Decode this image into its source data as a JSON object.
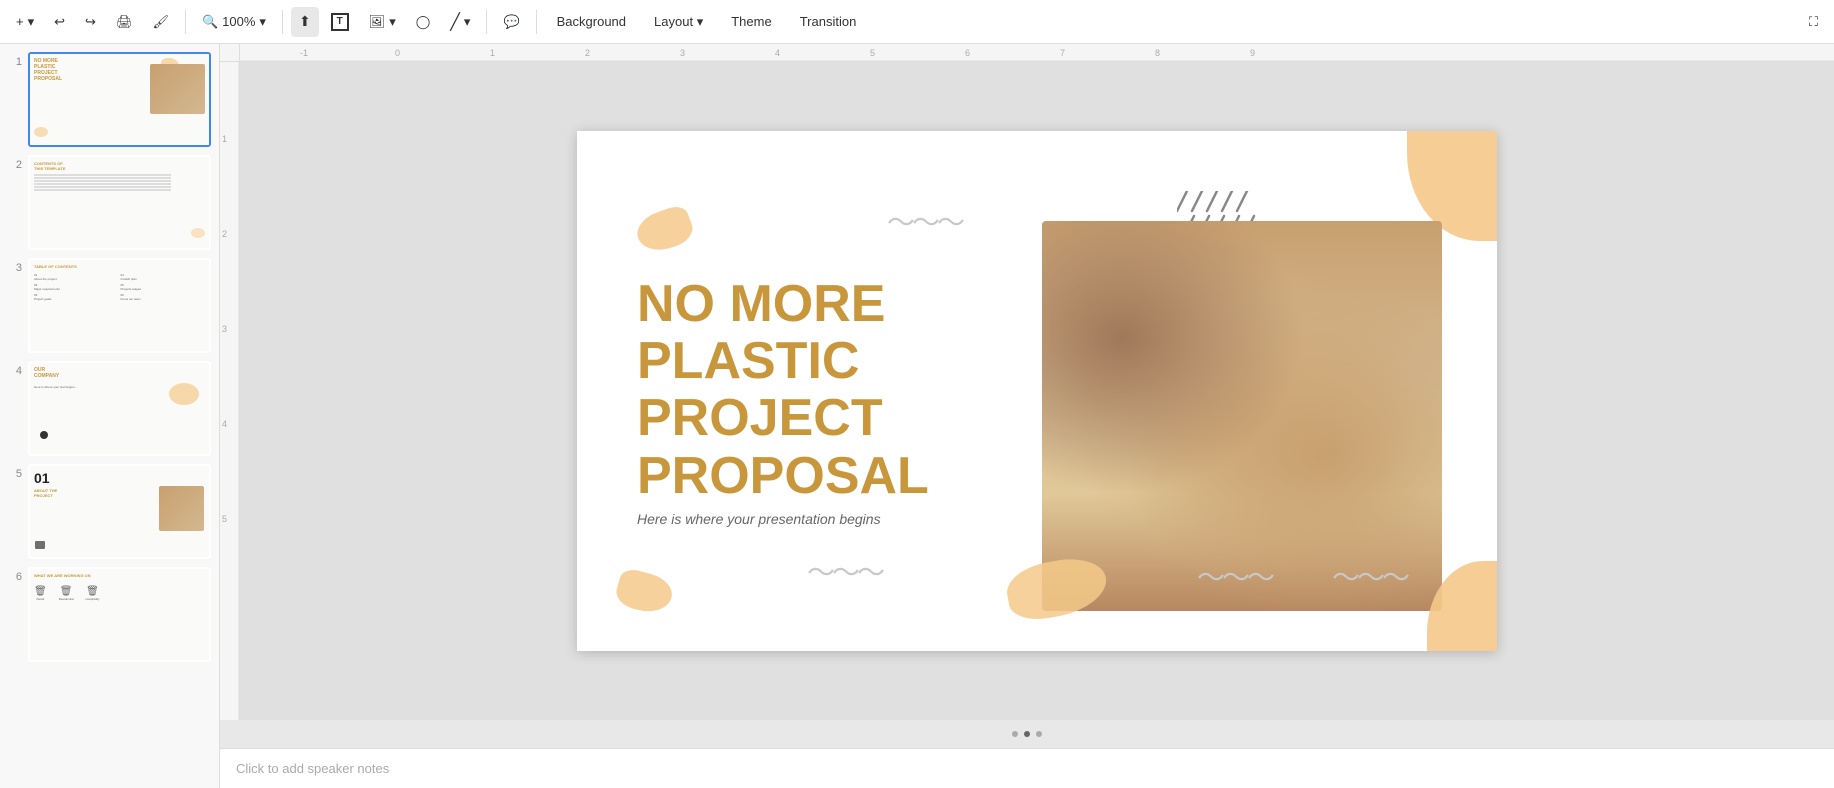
{
  "toolbar": {
    "add_label": "+",
    "undo_label": "↩",
    "redo_label": "↪",
    "print_label": "🖨",
    "paintformat_label": "🖌",
    "zoom_label": "100%",
    "select_label": "▶",
    "textbox_label": "T",
    "image_label": "🖼",
    "shapes_label": "◯",
    "lines_label": "/",
    "comment_label": "💬",
    "background_label": "Background",
    "layout_label": "Layout",
    "theme_label": "Theme",
    "transition_label": "Transition",
    "expand_label": "⛶"
  },
  "slides": [
    {
      "num": "1",
      "title_line1": "NO MORE",
      "title_line2": "PLASTIC",
      "title_line3": "PROJECT",
      "title_line4": "PROPOSAL",
      "active": true
    },
    {
      "num": "2",
      "title": "CONTENTS OF THIS TEMPLATE",
      "active": false
    },
    {
      "num": "3",
      "title": "TABLE OF CONTENTS",
      "active": false
    },
    {
      "num": "4",
      "title": "OUR COMPANY",
      "active": false
    },
    {
      "num": "5",
      "title": "01\nABOUT THE\nPROJECT",
      "active": false
    },
    {
      "num": "6",
      "title": "WHAT WE ARE WORKING ON",
      "active": false
    }
  ],
  "main_slide": {
    "title_line1": "NO MORE",
    "title_line2": "PLASTIC",
    "title_line3": "PROJECT",
    "title_line4": "PROPOSAL",
    "subtitle": "Here is where your presentation begins"
  },
  "notes": {
    "placeholder": "Click to add speaker notes"
  },
  "dots": [
    "•",
    "•",
    "•"
  ],
  "ruler": {
    "h_labels": [
      "-1",
      "0",
      "1",
      "2",
      "3",
      "4",
      "5",
      "6",
      "7",
      "8",
      "9"
    ],
    "v_labels": [
      "1",
      "2",
      "3",
      "4",
      "5"
    ]
  }
}
